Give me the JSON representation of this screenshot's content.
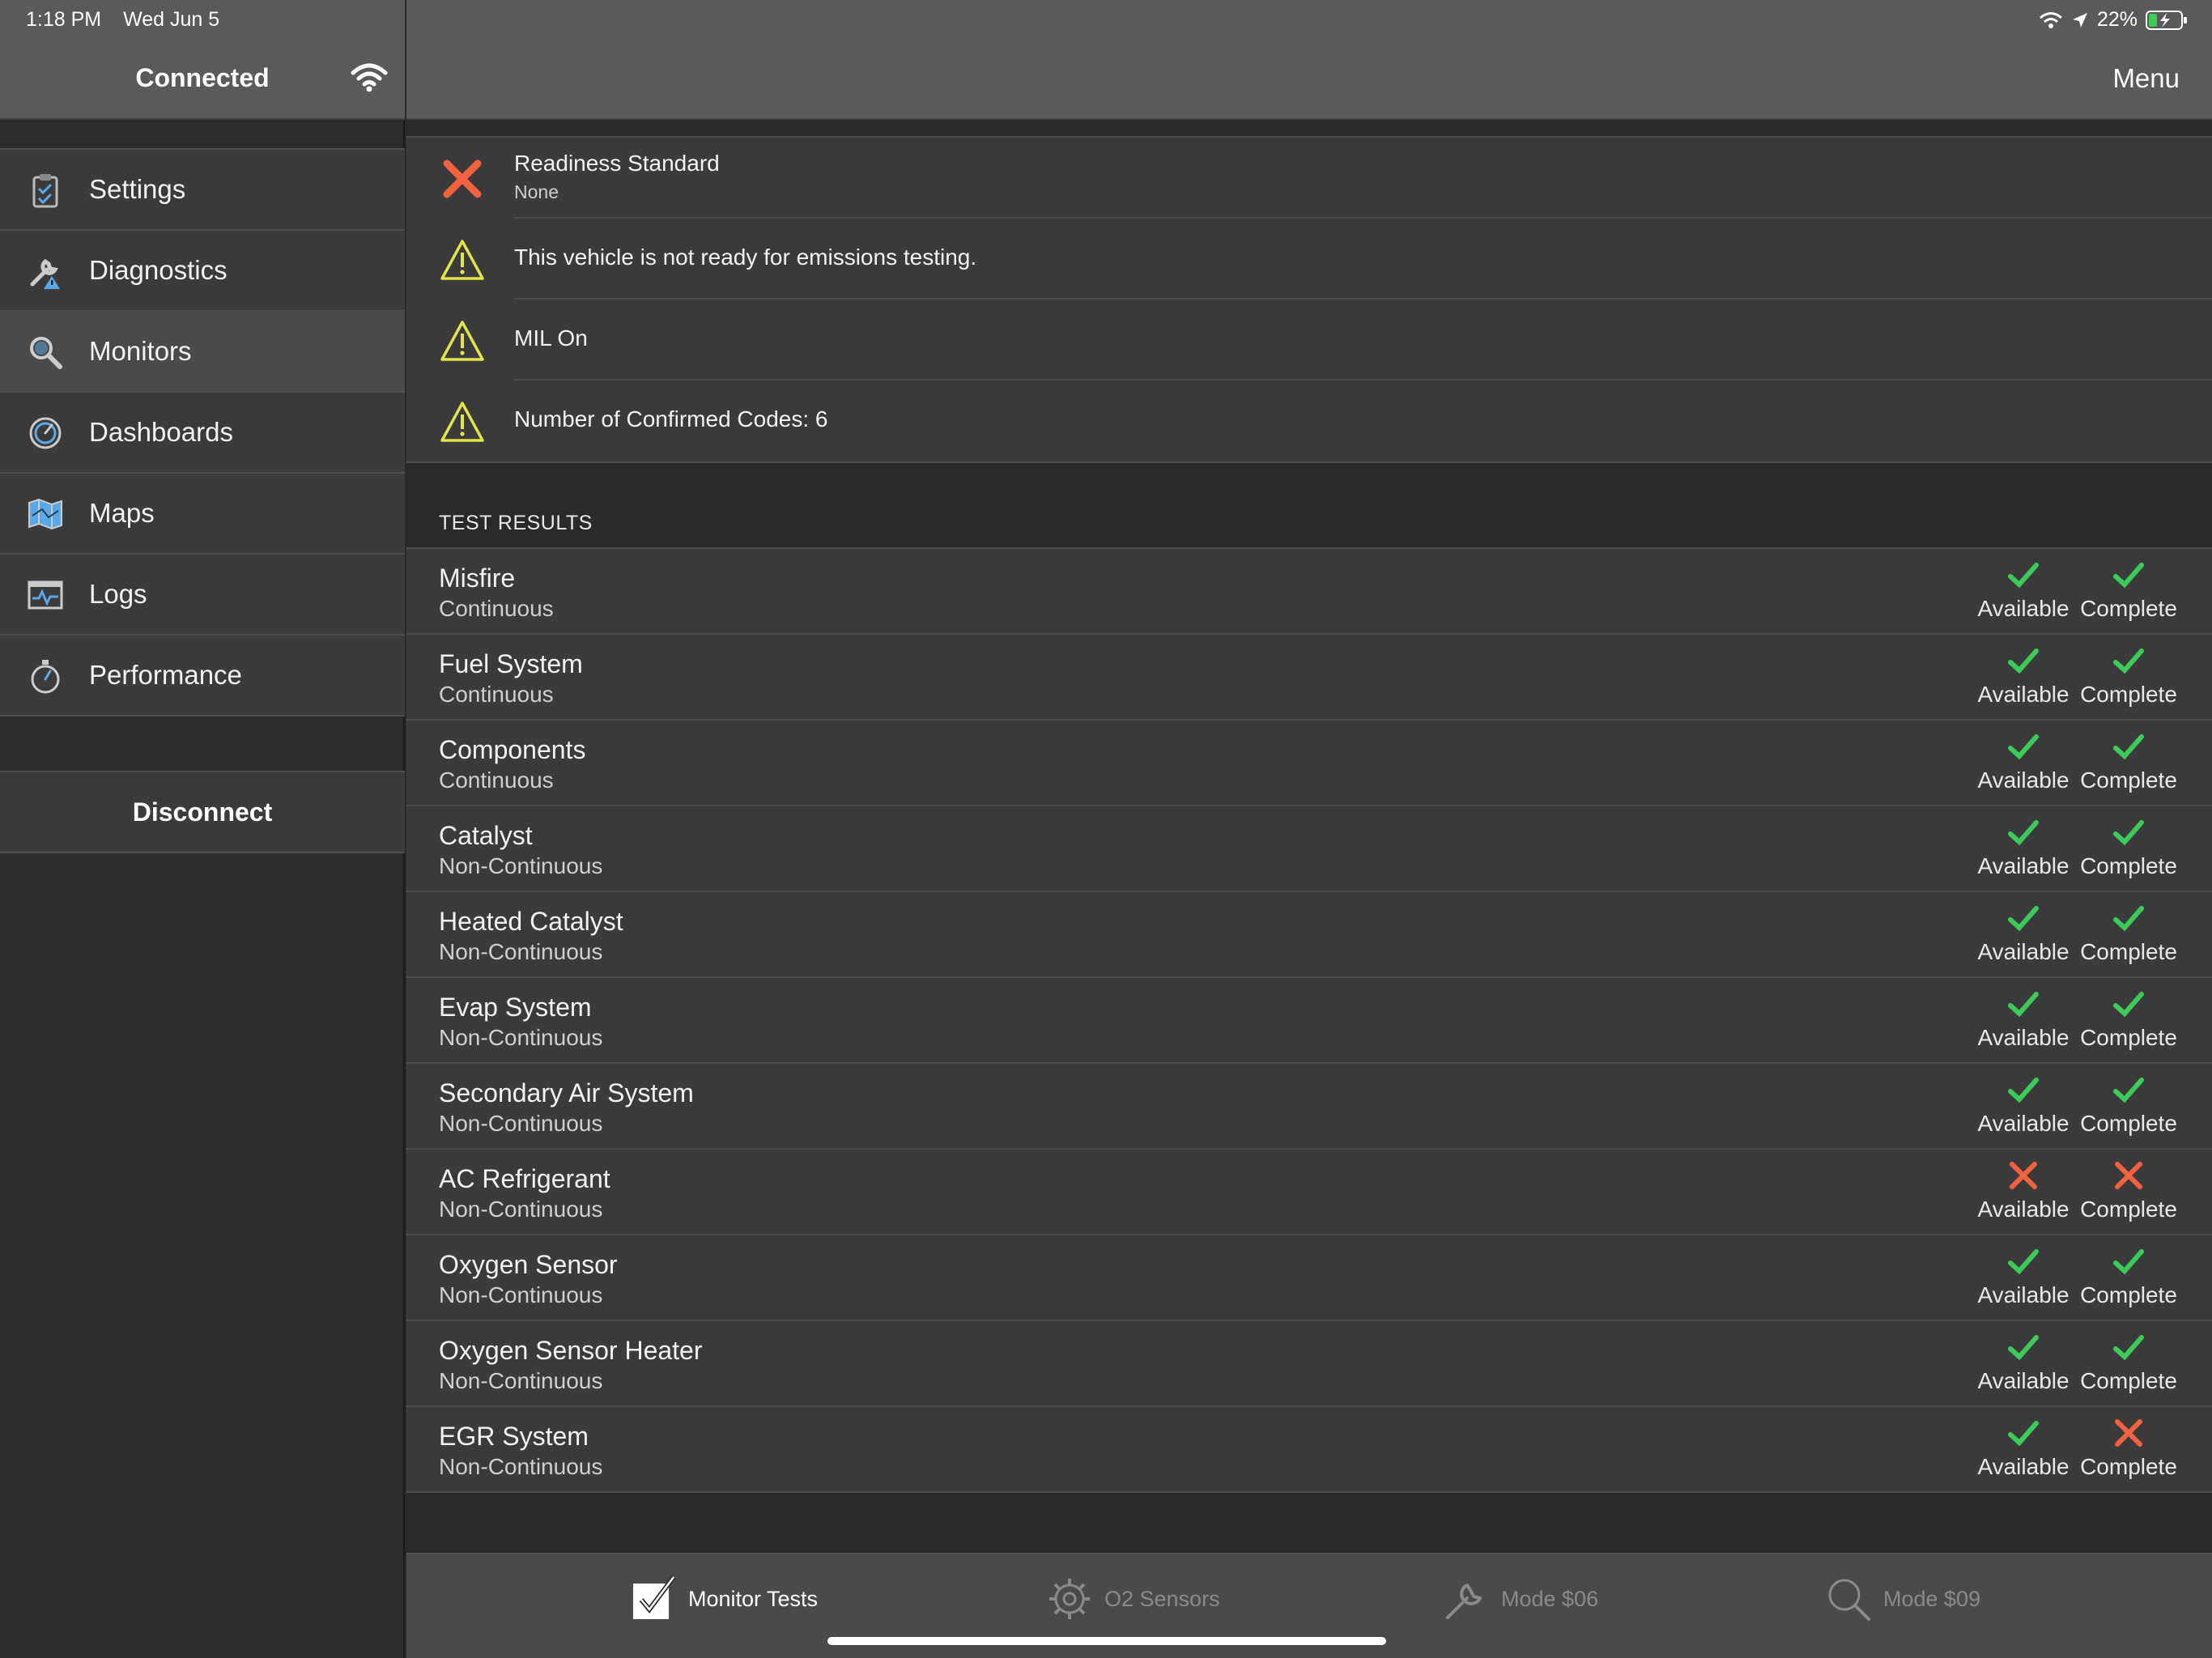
{
  "status_bar": {
    "time": "1:18 PM",
    "date": "Wed Jun 5",
    "battery": "22%"
  },
  "sidebar": {
    "title": "Connected",
    "items": [
      {
        "label": "Settings",
        "icon": "clipboard-check-icon"
      },
      {
        "label": "Diagnostics",
        "icon": "wrench-warning-icon"
      },
      {
        "label": "Monitors",
        "icon": "magnifier-icon"
      },
      {
        "label": "Dashboards",
        "icon": "gauge-icon"
      },
      {
        "label": "Maps",
        "icon": "map-icon"
      },
      {
        "label": "Logs",
        "icon": "pulse-log-icon"
      },
      {
        "label": "Performance",
        "icon": "stopwatch-icon"
      }
    ],
    "selected_index": 2,
    "disconnect_label": "Disconnect"
  },
  "header": {
    "menu_label": "Menu"
  },
  "alerts": {
    "readiness_title": "Readiness Standard",
    "readiness_value": "None",
    "messages": [
      "This vehicle is not ready for emissions testing.",
      "MIL On",
      "Number of Confirmed Codes: 6"
    ]
  },
  "test_results": {
    "section_title": "TEST RESULTS",
    "available_label": "Available",
    "complete_label": "Complete",
    "rows": [
      {
        "name": "Misfire",
        "type": "Continuous",
        "available": true,
        "complete": true
      },
      {
        "name": "Fuel System",
        "type": "Continuous",
        "available": true,
        "complete": true
      },
      {
        "name": "Components",
        "type": "Continuous",
        "available": true,
        "complete": true
      },
      {
        "name": "Catalyst",
        "type": "Non-Continuous",
        "available": true,
        "complete": true
      },
      {
        "name": "Heated Catalyst",
        "type": "Non-Continuous",
        "available": true,
        "complete": true
      },
      {
        "name": "Evap System",
        "type": "Non-Continuous",
        "available": true,
        "complete": true
      },
      {
        "name": "Secondary Air System",
        "type": "Non-Continuous",
        "available": true,
        "complete": true
      },
      {
        "name": "AC Refrigerant",
        "type": "Non-Continuous",
        "available": false,
        "complete": false
      },
      {
        "name": "Oxygen Sensor",
        "type": "Non-Continuous",
        "available": true,
        "complete": true
      },
      {
        "name": "Oxygen Sensor Heater",
        "type": "Non-Continuous",
        "available": true,
        "complete": true
      },
      {
        "name": "EGR System",
        "type": "Non-Continuous",
        "available": true,
        "complete": false
      }
    ]
  },
  "tabs": [
    {
      "label": "Monitor Tests",
      "icon": "checkbox-icon",
      "active": true
    },
    {
      "label": "O2 Sensors",
      "icon": "gear-icon",
      "active": false
    },
    {
      "label": "Mode $06",
      "icon": "wrench-icon",
      "active": false
    },
    {
      "label": "Mode $09",
      "icon": "search-icon",
      "active": false
    }
  ],
  "colors": {
    "ok": "#3ccb5a",
    "fail": "#f2623e",
    "warning": "#e3e34a",
    "accent_icon": "#5aa9e6"
  }
}
